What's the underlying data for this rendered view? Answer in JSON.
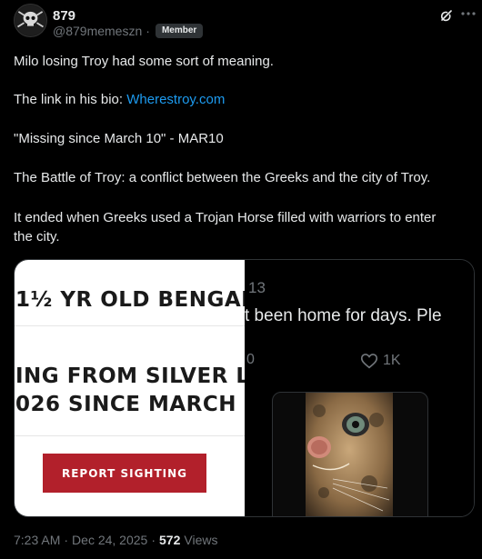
{
  "author": {
    "display_name": "879",
    "handle": "@879memeszn",
    "separator": "·",
    "badge": "Member",
    "avatar_icon": "skull-avatar-icon"
  },
  "post": {
    "lines": [
      "Milo losing Troy had some sort of meaning.",
      "The link in his bio: ",
      "\"Missing since March 10\" - MAR10",
      "The Battle of Troy: a conflict between the Greeks and the city of Troy.",
      "It ended when Greeks used a Trojan Horse filled with warriors to enter",
      "the city."
    ],
    "link_text": "Wherestroy.com"
  },
  "media": {
    "poster": {
      "line1": "1½ YR OLD BENGAL",
      "line2": "ING FROM SILVER L",
      "line3": "026 SINCE MARCH",
      "button": "REPORT SIGHTING"
    },
    "tweet": {
      "count": "13",
      "text": "t been home for days. Ple",
      "left_count": "0",
      "like_count": "1K"
    }
  },
  "meta": {
    "time": "7:23 AM",
    "date": "Dec 24, 2025",
    "separator": "·",
    "views_count": "572",
    "views_label": "Views"
  },
  "colors": {
    "background": "#000000",
    "text": "#e7e9ea",
    "muted": "#71767b",
    "link": "#1d9bf0",
    "report_button": "#b2202b"
  }
}
